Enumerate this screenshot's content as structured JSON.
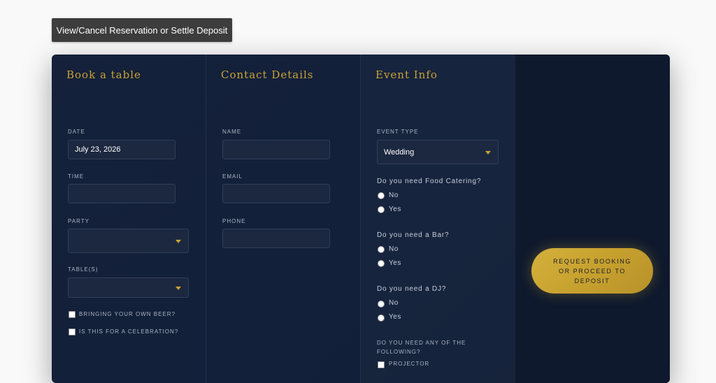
{
  "top_button": {
    "label": "View/Cancel Reservation or Settle Deposit"
  },
  "book": {
    "title": "Book a table",
    "date_label": "DATE",
    "date_value": "July 23, 2026",
    "time_label": "TIME",
    "time_value": "",
    "party_label": "PARTY",
    "party_value": "",
    "tables_label": "TABLE(S)",
    "tables_value": "",
    "byob_label": "BRINGING YOUR OWN BEER?",
    "celebration_label": "IS THIS FOR A CELEBRATION?"
  },
  "contact": {
    "title": "Contact Details",
    "name_label": "NAME",
    "email_label": "EMAIL",
    "phone_label": "PHONE"
  },
  "event": {
    "title": "Event Info",
    "type_label": "EVENT TYPE",
    "type_value": "Wedding",
    "catering_q": "Do you need Food Catering?",
    "bar_q": "Do you need a Bar?",
    "dj_q": "Do you need a DJ?",
    "no": "No",
    "yes": "Yes",
    "following_q": "DO YOU NEED ANY OF THE FOLLOWING?",
    "projector": "PROJECTOR"
  },
  "cta": {
    "label": "REQUEST BOOKING OR PROCEED TO DEPOSIT"
  },
  "colors": {
    "accent": "#c9a334",
    "panel": "#13213a",
    "field": "#1c2840"
  }
}
